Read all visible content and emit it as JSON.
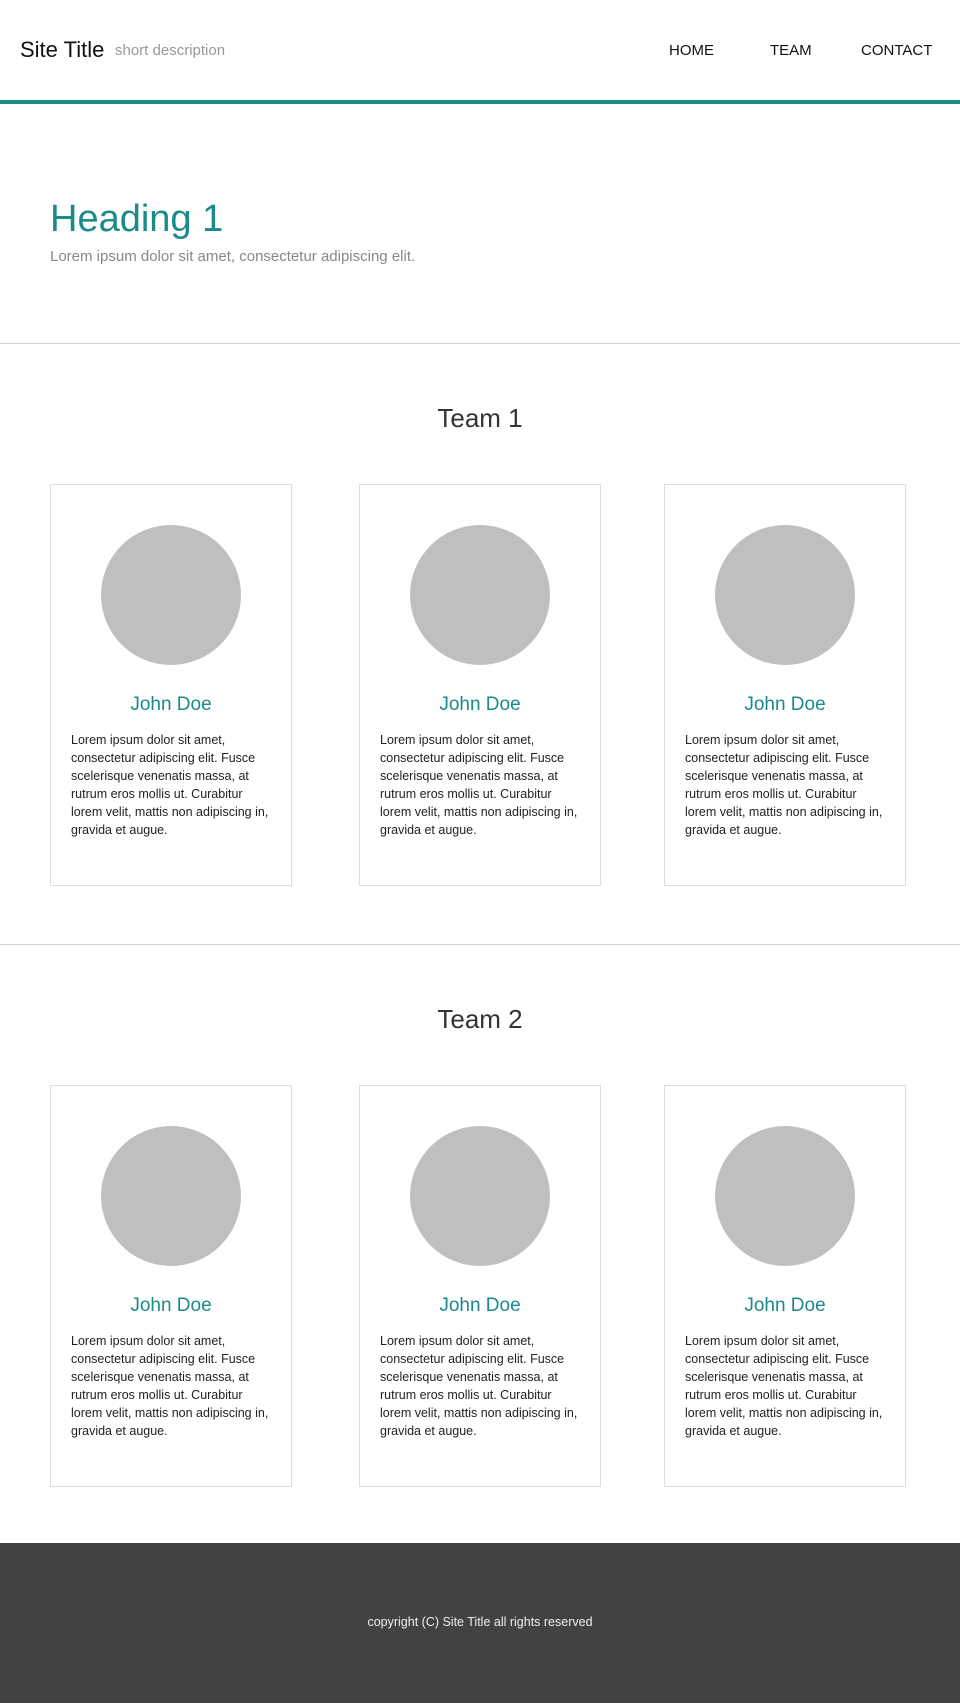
{
  "header": {
    "site_title": "Site Title",
    "site_description": "short description",
    "nav": [
      "HOME",
      "TEAM",
      "CONTACT"
    ]
  },
  "hero": {
    "heading": "Heading 1",
    "subtitle": "Lorem ipsum dolor sit amet, consectetur adipiscing elit."
  },
  "teams": [
    {
      "title": "Team 1",
      "members": [
        {
          "name": "John Doe",
          "bio": "Lorem ipsum dolor sit amet, consectetur adipiscing elit. Fusce scelerisque venenatis massa, at rutrum eros mollis ut. Curabitur lorem velit, mattis non adipiscing in, gravida et augue."
        },
        {
          "name": "John Doe",
          "bio": "Lorem ipsum dolor sit amet, consectetur adipiscing elit. Fusce scelerisque venenatis massa, at rutrum eros mollis ut. Curabitur lorem velit, mattis non adipiscing in, gravida et augue."
        },
        {
          "name": "John Doe",
          "bio": "Lorem ipsum dolor sit amet, consectetur adipiscing elit. Fusce scelerisque venenatis massa, at rutrum eros mollis ut. Curabitur lorem velit, mattis non adipiscing in, gravida et augue."
        }
      ]
    },
    {
      "title": "Team 2",
      "members": [
        {
          "name": "John Doe",
          "bio": "Lorem ipsum dolor sit amet, consectetur adipiscing elit. Fusce scelerisque venenatis massa, at rutrum eros mollis ut. Curabitur lorem velit, mattis non adipiscing in, gravida et augue."
        },
        {
          "name": "John Doe",
          "bio": "Lorem ipsum dolor sit amet, consectetur adipiscing elit. Fusce scelerisque venenatis massa, at rutrum eros mollis ut. Curabitur lorem velit, mattis non adipiscing in, gravida et augue."
        },
        {
          "name": "John Doe",
          "bio": "Lorem ipsum dolor sit amet, consectetur adipiscing elit. Fusce scelerisque venenatis massa, at rutrum eros mollis ut. Curabitur lorem velit, mattis non adipiscing in, gravida et augue."
        }
      ]
    }
  ],
  "footer": {
    "copyright": "copyright (C) Site Title all rights reserved"
  },
  "colors": {
    "accent": "#1a8a8a",
    "footer_bg": "#424242",
    "avatar_placeholder": "#bfbfbf"
  }
}
